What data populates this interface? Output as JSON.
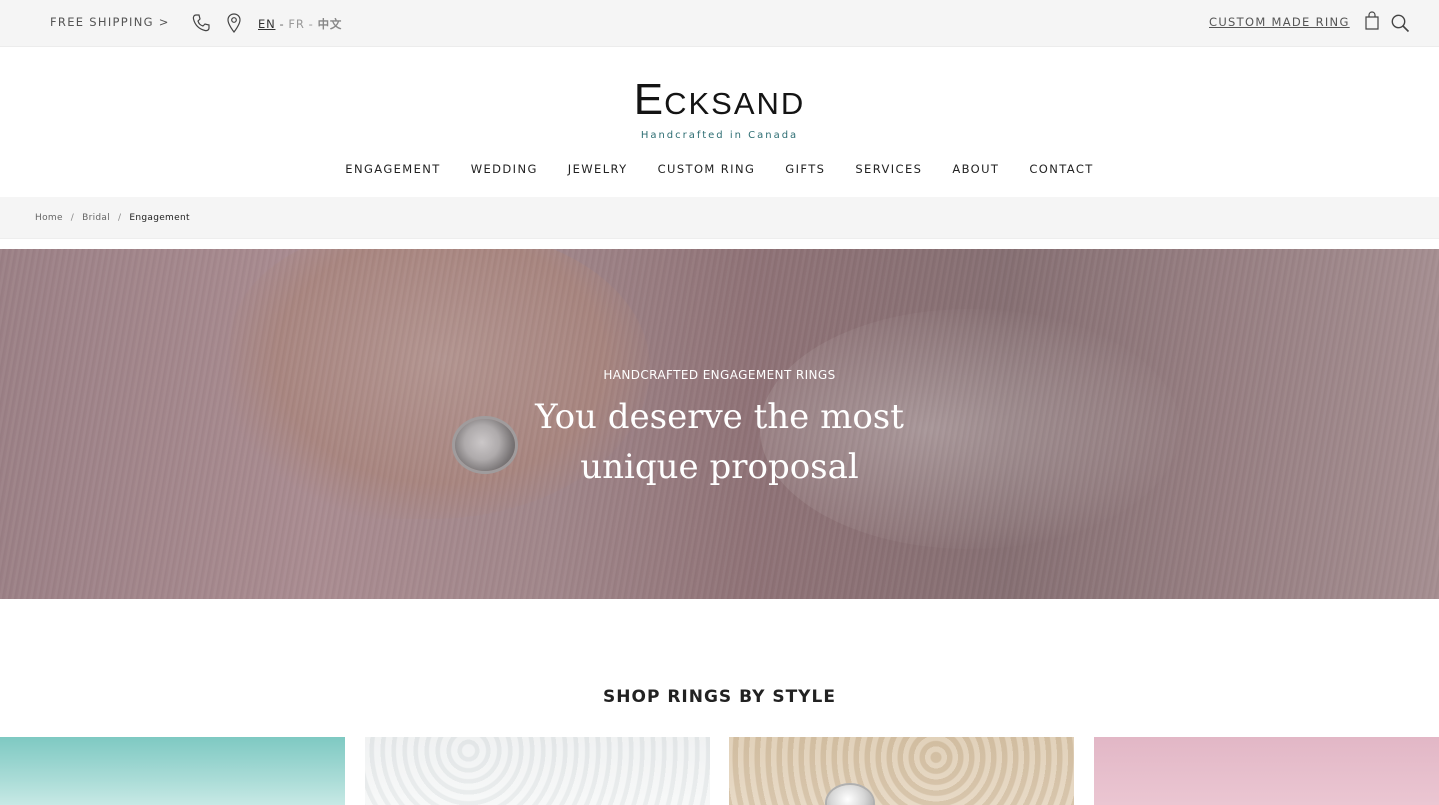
{
  "topbar": {
    "shipping": "FREE SHIPPING >",
    "phone_icon": "phone-icon",
    "location_icon": "map-pin-icon",
    "languages": {
      "en": "EN",
      "sep1": "-",
      "fr": "FR",
      "sep2": "-",
      "zh": "中文"
    },
    "custom_link": "CUSTOM MADE RING",
    "bag_icon": "shopping-bag-icon",
    "search_icon": "search-icon"
  },
  "brand": {
    "initial": "E",
    "rest": "CKSAND",
    "tagline": "Handcrafted in Canada"
  },
  "nav": [
    "ENGAGEMENT",
    "WEDDING",
    "JEWELRY",
    "CUSTOM RING",
    "GIFTS",
    "SERVICES",
    "ABOUT",
    "CONTACT"
  ],
  "breadcrumb": {
    "home": "Home",
    "sep": "/",
    "bridal": "Bridal",
    "current": "Engagement"
  },
  "hero": {
    "eyebrow": "HANDCRAFTED ENGAGEMENT RINGS",
    "heading_line1": "You deserve the most",
    "heading_line2": "unique proposal"
  },
  "section": {
    "title": "SHOP RINGS BY STYLE"
  },
  "colors": {
    "topbar_bg": "#f5f5f5",
    "tagline": "#2e6e73",
    "text": "#222222"
  }
}
